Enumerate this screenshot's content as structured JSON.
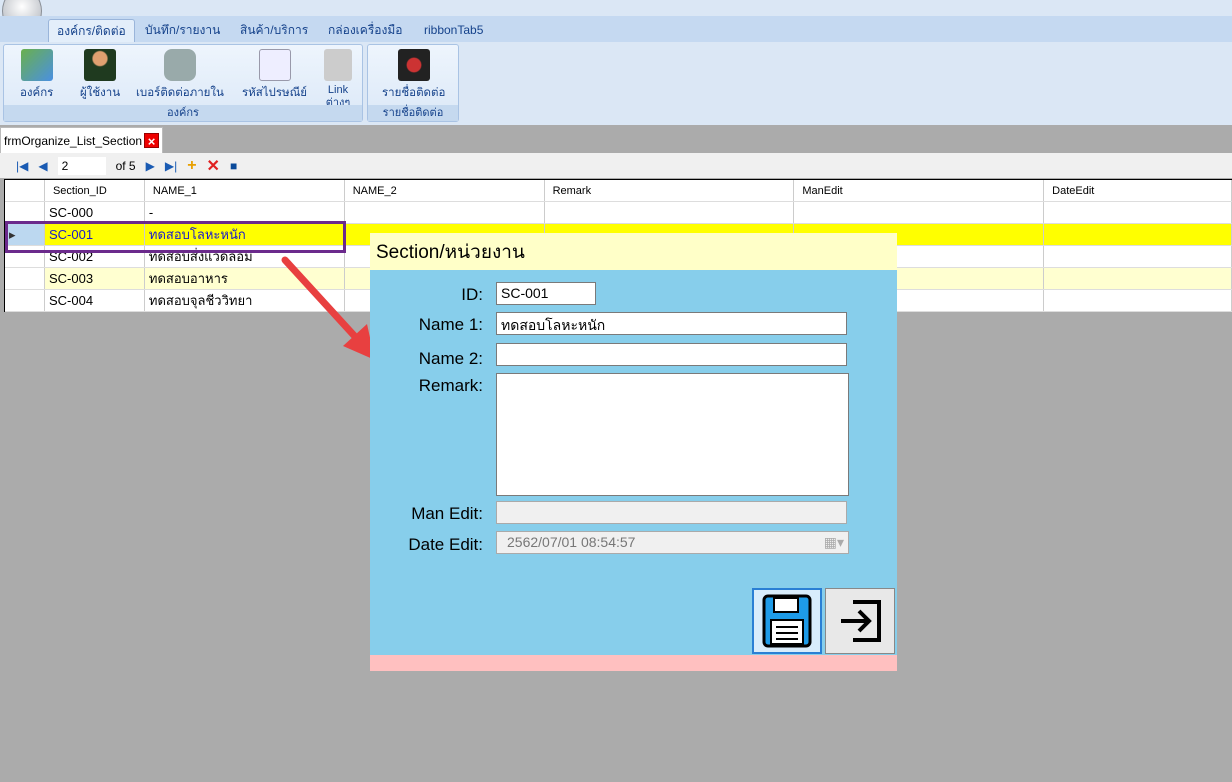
{
  "ribbon": {
    "tabs": [
      "องค์กร/ติดต่อ",
      "บันทึก/รายงาน",
      "สินค้า/บริการ",
      "กล่องเครื่องมือ",
      "ribbonTab5"
    ],
    "group1": {
      "label": "องค์กร",
      "buttons": [
        "องค์กร",
        "ผู้ใช้งาน",
        "เบอร์ติดต่อภายใน",
        "รหัสไปรษณีย์",
        "Link ต่างๆ"
      ]
    },
    "group2": {
      "label": "รายชื่อติดต่อ",
      "buttons": [
        "รายชื่อติดต่อ"
      ]
    }
  },
  "doc_tab": "frmOrganize_List_Section",
  "nav": {
    "position": "2",
    "of": "of 5"
  },
  "grid": {
    "columns": [
      "Section_ID",
      "NAME_1",
      "NAME_2",
      "Remark",
      "ManEdit",
      "DateEdit"
    ],
    "rows": [
      [
        "SC-000",
        "-"
      ],
      [
        "SC-001",
        "ทดสอบโลหะหนัก"
      ],
      [
        "SC-002",
        "ทดสอบสิ่งแวดล้อม"
      ],
      [
        "SC-003",
        "ทดสอบอาหาร"
      ],
      [
        "SC-004",
        "ทดสอบจุลชีววิทยา"
      ]
    ]
  },
  "dialog": {
    "title": "Section/หน่วยงาน",
    "labels": {
      "id": "ID:",
      "name1": "Name 1:",
      "name2": "Name 2:",
      "remark": "Remark:",
      "manedit": "Man Edit:",
      "dateedit": "Date Edit:"
    },
    "values": {
      "id": "SC-001",
      "name1": "ทดสอบโลหะหนัก",
      "name2": "",
      "remark": "",
      "manedit": "",
      "dateedit": "2562/07/01 08:54:57"
    }
  }
}
